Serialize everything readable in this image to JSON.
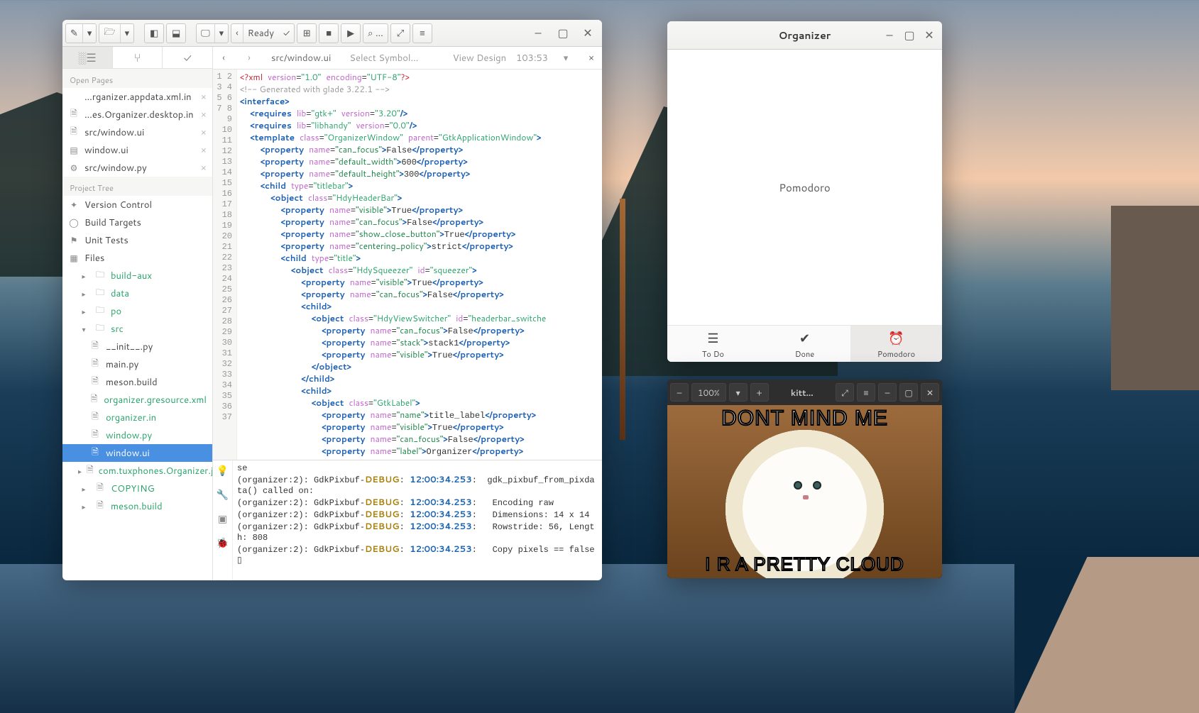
{
  "ide": {
    "ready_btn": "Ready",
    "tabs": {
      "nav_prev": "‹",
      "nav_next": "›",
      "path": "src/window.ui",
      "symbol": "Select Symbol…",
      "design": "View Design",
      "cursor_pos": "103:53",
      "close": "×"
    },
    "open_pages_label": "Open Pages",
    "open_pages": [
      {
        "icon": "</>",
        "name": "…rganizer.appdata.xml.in"
      },
      {
        "icon": "🗎",
        "name": "…es.Organizer.desktop.in"
      },
      {
        "icon": "🗎",
        "name": "src/window.ui"
      },
      {
        "icon": "▤",
        "name": "window.ui"
      },
      {
        "icon": "⚙",
        "name": "src/window.py"
      }
    ],
    "project_tree_label": "Project Tree",
    "project_top": [
      {
        "icon": "✦",
        "name": "Version Control"
      },
      {
        "icon": "◯",
        "name": "Build Targets"
      },
      {
        "icon": "⚑",
        "name": "Unit Tests"
      }
    ],
    "files_label": "Files",
    "folders": [
      {
        "name": "build-aux"
      },
      {
        "name": "data"
      },
      {
        "name": "po"
      }
    ],
    "src_label": "src",
    "src_files": [
      {
        "name": "__init__.py",
        "dirty": false
      },
      {
        "name": "main.py",
        "dirty": false
      },
      {
        "name": "meson.build",
        "dirty": false
      },
      {
        "name": "organizer.gresource.xml",
        "dirty": true
      },
      {
        "name": "organizer.in",
        "dirty": true
      },
      {
        "name": "window.py",
        "dirty": true
      },
      {
        "name": "window.ui",
        "dirty": true,
        "selected": true
      }
    ],
    "rest": [
      {
        "name": "com.tuxphones.Organizer.js",
        "dirty": true
      },
      {
        "name": "COPYING",
        "dirty": true
      },
      {
        "name": "meson.build",
        "dirty": true
      }
    ],
    "line_count": 37,
    "log": {
      "lines": [
        "se",
        "(organizer:2): GdkPixbuf-|DEBUG|: |12:00:34.253|:  gdk_pixbuf_from_pixdata() called on:",
        "(organizer:2): GdkPixbuf-|DEBUG|: |12:00:34.253|:   Encoding raw",
        "(organizer:2): GdkPixbuf-|DEBUG|: |12:00:34.253|:   Dimensions: 14 x 14",
        "(organizer:2): GdkPixbuf-|DEBUG|: |12:00:34.253|:   Rowstride: 56, Length: 808",
        "(organizer:2): GdkPixbuf-|DEBUG|: |12:00:34.253|:   Copy pixels == false",
        "▯"
      ]
    }
  },
  "organizer": {
    "title": "Organizer",
    "body": "Pomodoro",
    "tabs": [
      {
        "icon": "☰",
        "label": "To Do"
      },
      {
        "icon": "✔",
        "label": "Done"
      },
      {
        "icon": "⏰",
        "label": "Pomodoro",
        "active": true
      }
    ]
  },
  "viewer": {
    "zoom": "100%",
    "title": "kitt…",
    "caption_top": "DONT MIND ME",
    "caption_bottom": "I R A PRETTY CLOUD"
  }
}
